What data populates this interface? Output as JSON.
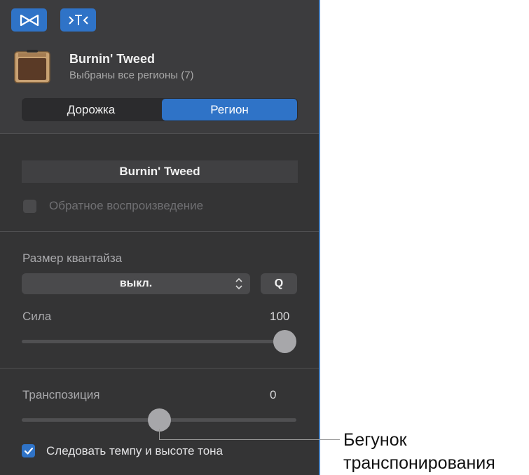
{
  "header": {
    "icon_left": "bowtie-icon",
    "icon_right": "split-filter-icon",
    "title": "Burnin' Tweed",
    "subtitle": "Выбраны все регионы (7)",
    "tabs": [
      {
        "label": "Дорожка",
        "selected": false
      },
      {
        "label": "Регион",
        "selected": true
      }
    ]
  },
  "region": {
    "name": "Burnin' Tweed",
    "reverse_label": "Обратное воспроизведение",
    "reverse_checked": false
  },
  "quantize": {
    "label": "Размер квантайза",
    "value": "выкл.",
    "q_button": "Q",
    "strength_label": "Сила",
    "strength_value": "100"
  },
  "transpose": {
    "label": "Транспозиция",
    "value": "0",
    "slider_fraction": 0.5,
    "follow_label": "Следовать темпу и высоте тона",
    "follow_checked": true
  },
  "callout": {
    "line1": "Бегунок",
    "line2": "транспонирования"
  },
  "colors": {
    "accent": "#2f73c7",
    "panel_bg": "#343435",
    "header_bg": "#3c3c3e"
  }
}
